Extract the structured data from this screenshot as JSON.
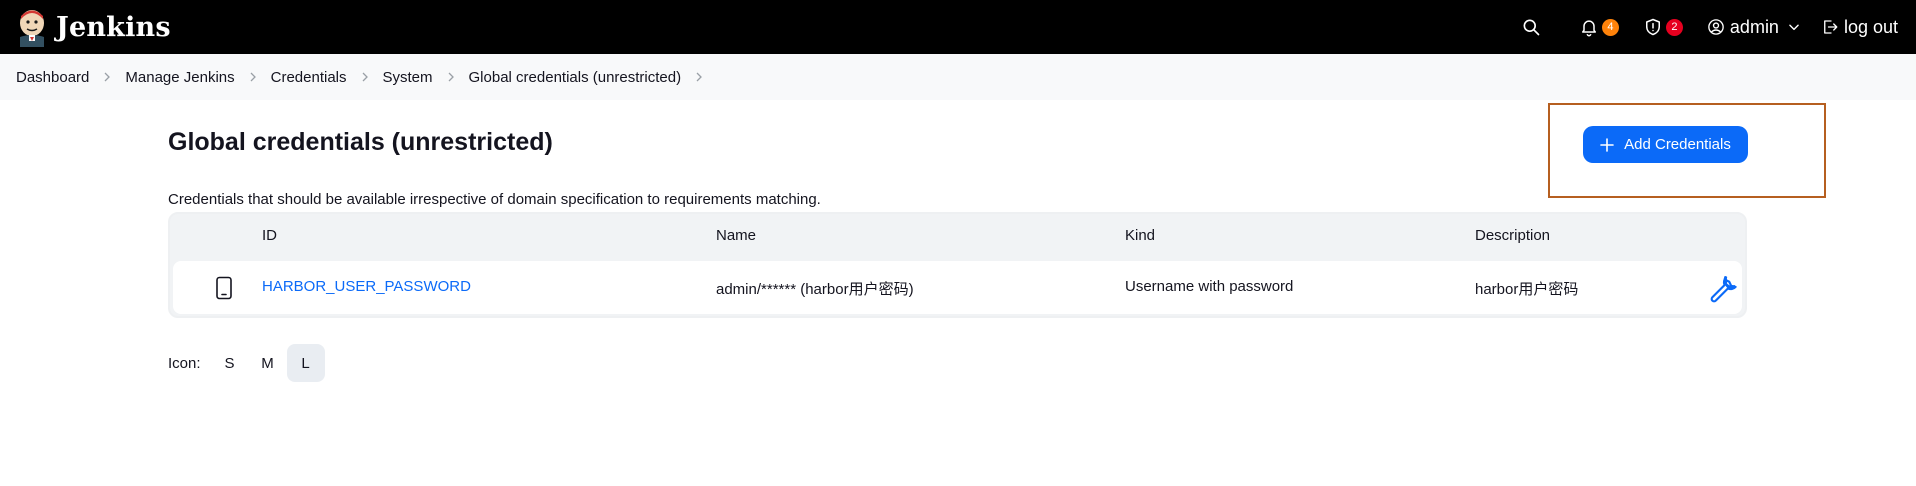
{
  "header": {
    "brand": "Jenkins",
    "notifications_count": "4",
    "security_count": "2",
    "user": "admin",
    "logout": "log out"
  },
  "breadcrumb": [
    "Dashboard",
    "Manage Jenkins",
    "Credentials",
    "System",
    "Global credentials (unrestricted)"
  ],
  "page": {
    "title": "Global credentials (unrestricted)",
    "description": "Credentials that should be available irrespective of domain specification to requirements matching.",
    "add_button": "Add Credentials"
  },
  "table": {
    "headers": {
      "id": "ID",
      "name": "Name",
      "kind": "Kind",
      "description": "Description"
    },
    "rows": [
      {
        "id": "HARBOR_USER_PASSWORD",
        "name": "admin/****** (harbor用户密码)",
        "kind": "Username with password",
        "description": "harbor用户密码"
      }
    ]
  },
  "icon_size": {
    "label": "Icon:",
    "options": [
      "S",
      "M",
      "L"
    ],
    "selected": "L"
  },
  "colors": {
    "accent": "#0b6af8",
    "header_bg": "#000000",
    "highlight_border": "#b65f20",
    "notification_badge": "#fe820a",
    "security_badge": "#e6001f"
  }
}
